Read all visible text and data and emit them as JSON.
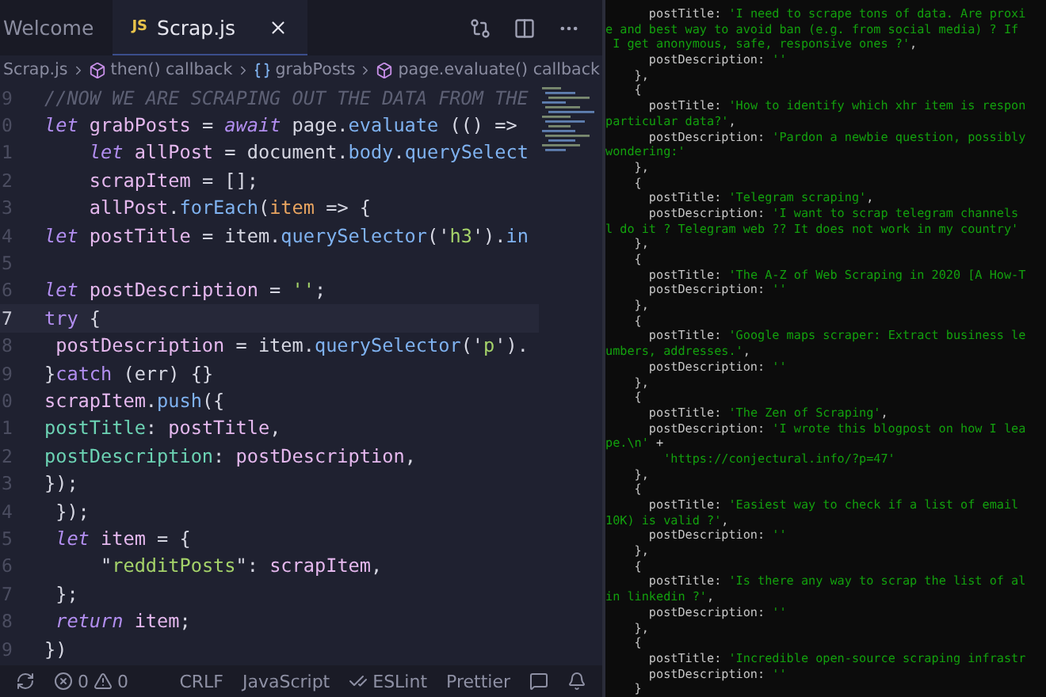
{
  "tabs": [
    {
      "label": "Welcome",
      "selected": false
    },
    {
      "label": "Scrap.js",
      "selected": true,
      "badge": "JS"
    }
  ],
  "breadcrumbs": [
    {
      "label": "Scrap.js",
      "kind": "file"
    },
    {
      "label": "then() callback",
      "kind": "function"
    },
    {
      "label": "grabPosts",
      "kind": "variable"
    },
    {
      "label": "page.evaluate() callback",
      "kind": "function"
    }
  ],
  "code": [
    {
      "number": "9",
      "current": false,
      "tokens": [
        {
          "t": "//NOW WE ARE SCRAPING OUT THE DATA FROM THE",
          "kind": "comment"
        }
      ]
    },
    {
      "number": "0",
      "current": false,
      "tokens": [
        {
          "t": "let",
          "kind": "keyword"
        },
        {
          "t": " grabPosts",
          "kind": "variable"
        },
        {
          "t": " = ",
          "kind": "plain"
        },
        {
          "t": "await",
          "kind": "keyword"
        },
        {
          "t": " page.",
          "kind": "plain"
        },
        {
          "t": "evaluate",
          "kind": "function"
        },
        {
          "t": " (() =>",
          "kind": "plain"
        }
      ]
    },
    {
      "number": "1",
      "current": false,
      "tokens": [
        {
          "t": "    let",
          "kind": "keyword"
        },
        {
          "t": " allPost",
          "kind": "variable"
        },
        {
          "t": " = document.",
          "kind": "plain"
        },
        {
          "t": "body",
          "kind": "function"
        },
        {
          "t": ".",
          "kind": "plain"
        },
        {
          "t": "querySelect",
          "kind": "function"
        }
      ]
    },
    {
      "number": "2",
      "current": false,
      "tokens": [
        {
          "t": "    scrapItem",
          "kind": "variable"
        },
        {
          "t": " = [];",
          "kind": "plain"
        }
      ]
    },
    {
      "number": "3",
      "current": false,
      "tokens": [
        {
          "t": "    allPost",
          "kind": "variable"
        },
        {
          "t": ".",
          "kind": "plain"
        },
        {
          "t": "forEach",
          "kind": "function"
        },
        {
          "t": "(",
          "kind": "plain"
        },
        {
          "t": "item",
          "kind": "param"
        },
        {
          "t": " => {",
          "kind": "plain"
        }
      ]
    },
    {
      "number": "4",
      "current": false,
      "tokens": [
        {
          "t": "let",
          "kind": "keyword"
        },
        {
          "t": " postTitle",
          "kind": "variable"
        },
        {
          "t": " = item.",
          "kind": "plain"
        },
        {
          "t": "querySelector",
          "kind": "function"
        },
        {
          "t": "('",
          "kind": "plain"
        },
        {
          "t": "h3",
          "kind": "string"
        },
        {
          "t": "').",
          "kind": "plain"
        },
        {
          "t": "in",
          "kind": "function"
        }
      ]
    },
    {
      "number": "5",
      "current": false
    },
    {
      "number": "6",
      "current": false,
      "tokens": [
        {
          "t": "let",
          "kind": "keyword"
        },
        {
          "t": " postDescription",
          "kind": "variable"
        },
        {
          "t": " = ",
          "kind": "plain"
        },
        {
          "t": "''",
          "kind": "string"
        },
        {
          "t": ";",
          "kind": "plain"
        }
      ]
    },
    {
      "number": "7",
      "current": true,
      "tokens": [
        {
          "t": "try",
          "kind": "control"
        },
        {
          "t": " {",
          "kind": "plain"
        }
      ]
    },
    {
      "number": "8",
      "current": false,
      "tokens": [
        {
          "t": " postDescription",
          "kind": "variable"
        },
        {
          "t": " = item.",
          "kind": "plain"
        },
        {
          "t": "querySelector",
          "kind": "function"
        },
        {
          "t": "('",
          "kind": "plain"
        },
        {
          "t": "p",
          "kind": "string"
        },
        {
          "t": "').",
          "kind": "plain"
        }
      ]
    },
    {
      "number": "9",
      "current": false,
      "tokens": [
        {
          "t": "}",
          "kind": "plain"
        },
        {
          "t": "catch",
          "kind": "control"
        },
        {
          "t": " (err) {}",
          "kind": "plain"
        }
      ]
    },
    {
      "number": "0",
      "current": false,
      "tokens": [
        {
          "t": "scrapItem",
          "kind": "variable"
        },
        {
          "t": ".",
          "kind": "plain"
        },
        {
          "t": "push",
          "kind": "function"
        },
        {
          "t": "({",
          "kind": "plain"
        }
      ]
    },
    {
      "number": "1",
      "current": false,
      "tokens": [
        {
          "t": "postTitle",
          "kind": "property"
        },
        {
          "t": ": ",
          "kind": "plain"
        },
        {
          "t": "postTitle",
          "kind": "variable"
        },
        {
          "t": ",",
          "kind": "plain"
        }
      ]
    },
    {
      "number": "2",
      "current": false,
      "tokens": [
        {
          "t": "postDescription",
          "kind": "property"
        },
        {
          "t": ": ",
          "kind": "plain"
        },
        {
          "t": "postDescription",
          "kind": "variable"
        },
        {
          "t": ",",
          "kind": "plain"
        }
      ]
    },
    {
      "number": "3",
      "current": false,
      "tokens": [
        {
          "t": "});",
          "kind": "plain"
        }
      ]
    },
    {
      "number": "4",
      "current": false,
      "tokens": [
        {
          "t": " });",
          "kind": "plain"
        }
      ]
    },
    {
      "number": "5",
      "current": false,
      "tokens": [
        {
          "t": " let",
          "kind": "keyword"
        },
        {
          "t": " item",
          "kind": "variable"
        },
        {
          "t": " = {",
          "kind": "plain"
        }
      ]
    },
    {
      "number": "6",
      "current": false,
      "tokens": [
        {
          "t": "     \"",
          "kind": "plain"
        },
        {
          "t": "redditPosts",
          "kind": "string"
        },
        {
          "t": "\": ",
          "kind": "plain"
        },
        {
          "t": "scrapItem",
          "kind": "variable"
        },
        {
          "t": ",",
          "kind": "plain"
        }
      ]
    },
    {
      "number": "7",
      "current": false,
      "tokens": [
        {
          "t": " };",
          "kind": "plain"
        }
      ]
    },
    {
      "number": "8",
      "current": false,
      "tokens": [
        {
          "t": " return",
          "kind": "keyword"
        },
        {
          "t": " item",
          "kind": "variable"
        },
        {
          "t": ";",
          "kind": "plain"
        }
      ]
    },
    {
      "number": "9",
      "current": false,
      "tokens": [
        {
          "t": "})",
          "kind": "plain"
        }
      ]
    }
  ],
  "status_bar": [
    {
      "kind": "sync"
    },
    {
      "kind": "problems",
      "errors": "0",
      "warnings": "0"
    },
    {
      "kind": "text",
      "label": "CRLF"
    },
    {
      "kind": "text",
      "label": "JavaScript"
    },
    {
      "kind": "check",
      "label": "ESLint"
    },
    {
      "kind": "text",
      "label": "Prettier"
    },
    {
      "kind": "feedback"
    },
    {
      "kind": "bell"
    }
  ],
  "terminal": [
    [
      {
        "t": "      postTitle: ",
        "kind": "key"
      },
      {
        "t": "'I need to scrape tons of data. Are proxi",
        "kind": "string"
      }
    ],
    [
      {
        "t": "e and best way to avoid ban (e.g. from social media) ? If",
        "kind": "string"
      }
    ],
    [
      {
        "t": " I get anonymous, safe, responsive ones ?'",
        "kind": "string"
      },
      {
        "t": ",",
        "kind": "key"
      }
    ],
    [
      {
        "t": "      postDescription: ",
        "kind": "key"
      },
      {
        "t": "''",
        "kind": "string"
      }
    ],
    [
      {
        "t": "    },",
        "kind": "key"
      }
    ],
    [
      {
        "t": "    {",
        "kind": "key"
      }
    ],
    [
      {
        "t": "      postTitle: ",
        "kind": "key"
      },
      {
        "t": "'How to identify which xhr item is respon",
        "kind": "string"
      }
    ],
    [
      {
        "t": "particular data?'",
        "kind": "string"
      },
      {
        "t": ",",
        "kind": "key"
      }
    ],
    [
      {
        "t": "      postDescription: ",
        "kind": "key"
      },
      {
        "t": "'Pardon a newbie question, possibly",
        "kind": "string"
      }
    ],
    [
      {
        "t": "wondering:'",
        "kind": "string"
      }
    ],
    [
      {
        "t": "    },",
        "kind": "key"
      }
    ],
    [
      {
        "t": "    {",
        "kind": "key"
      }
    ],
    [
      {
        "t": "      postTitle: ",
        "kind": "key"
      },
      {
        "t": "'Telegram scraping'",
        "kind": "string"
      },
      {
        "t": ",",
        "kind": "key"
      }
    ],
    [
      {
        "t": "      postDescription: ",
        "kind": "key"
      },
      {
        "t": "'I want to scrap telegram channels",
        "kind": "string"
      }
    ],
    [
      {
        "t": "l do it ? Telegram web ?? It does not work in my country'",
        "kind": "string"
      }
    ],
    [
      {
        "t": "    },",
        "kind": "key"
      }
    ],
    [
      {
        "t": "    {",
        "kind": "key"
      }
    ],
    [
      {
        "t": "      postTitle: ",
        "kind": "key"
      },
      {
        "t": "'The A-Z of Web Scraping in 2020 [A How-T",
        "kind": "string"
      }
    ],
    [
      {
        "t": "      postDescription: ",
        "kind": "key"
      },
      {
        "t": "''",
        "kind": "string"
      }
    ],
    [
      {
        "t": "    },",
        "kind": "key"
      }
    ],
    [
      {
        "t": "    {",
        "kind": "key"
      }
    ],
    [
      {
        "t": "      postTitle: ",
        "kind": "key"
      },
      {
        "t": "'Google maps scraper: Extract business le",
        "kind": "string"
      }
    ],
    [
      {
        "t": "umbers, addresses.'",
        "kind": "string"
      },
      {
        "t": ",",
        "kind": "key"
      }
    ],
    [
      {
        "t": "      postDescription: ",
        "kind": "key"
      },
      {
        "t": "''",
        "kind": "string"
      }
    ],
    [
      {
        "t": "    },",
        "kind": "key"
      }
    ],
    [
      {
        "t": "    {",
        "kind": "key"
      }
    ],
    [
      {
        "t": "      postTitle: ",
        "kind": "key"
      },
      {
        "t": "'The Zen of Scraping'",
        "kind": "string"
      },
      {
        "t": ",",
        "kind": "key"
      }
    ],
    [
      {
        "t": "      postDescription: ",
        "kind": "key"
      },
      {
        "t": "'I wrote this blogpost on how I lea",
        "kind": "string"
      }
    ],
    [
      {
        "t": "pe.\\n'",
        "kind": "string"
      },
      {
        "t": " +",
        "kind": "key"
      }
    ],
    [
      {
        "t": "        'https://conjectural.info/?p=47'",
        "kind": "string"
      }
    ],
    [
      {
        "t": "    },",
        "kind": "key"
      }
    ],
    [
      {
        "t": "    {",
        "kind": "key"
      }
    ],
    [
      {
        "t": "      postTitle: ",
        "kind": "key"
      },
      {
        "t": "'Easiest way to check if a list of email",
        "kind": "string"
      }
    ],
    [
      {
        "t": "10K) is valid ?'",
        "kind": "string"
      },
      {
        "t": ",",
        "kind": "key"
      }
    ],
    [
      {
        "t": "      postDescription: ",
        "kind": "key"
      },
      {
        "t": "''",
        "kind": "string"
      }
    ],
    [
      {
        "t": "    },",
        "kind": "key"
      }
    ],
    [
      {
        "t": "    {",
        "kind": "key"
      }
    ],
    [
      {
        "t": "      postTitle: ",
        "kind": "key"
      },
      {
        "t": "'Is there any way to scrap the list of al",
        "kind": "string"
      }
    ],
    [
      {
        "t": "in linkedin ?'",
        "kind": "string"
      },
      {
        "t": ",",
        "kind": "key"
      }
    ],
    [
      {
        "t": "      postDescription: ",
        "kind": "key"
      },
      {
        "t": "''",
        "kind": "string"
      }
    ],
    [
      {
        "t": "    },",
        "kind": "key"
      }
    ],
    [
      {
        "t": "    {",
        "kind": "key"
      }
    ],
    [
      {
        "t": "      postTitle: ",
        "kind": "key"
      },
      {
        "t": "'Incredible open-source scraping infrastr",
        "kind": "string"
      }
    ],
    [
      {
        "t": "      postDescription: ",
        "kind": "key"
      },
      {
        "t": "''",
        "kind": "string"
      }
    ],
    [
      {
        "t": "    }",
        "kind": "key"
      }
    ]
  ]
}
